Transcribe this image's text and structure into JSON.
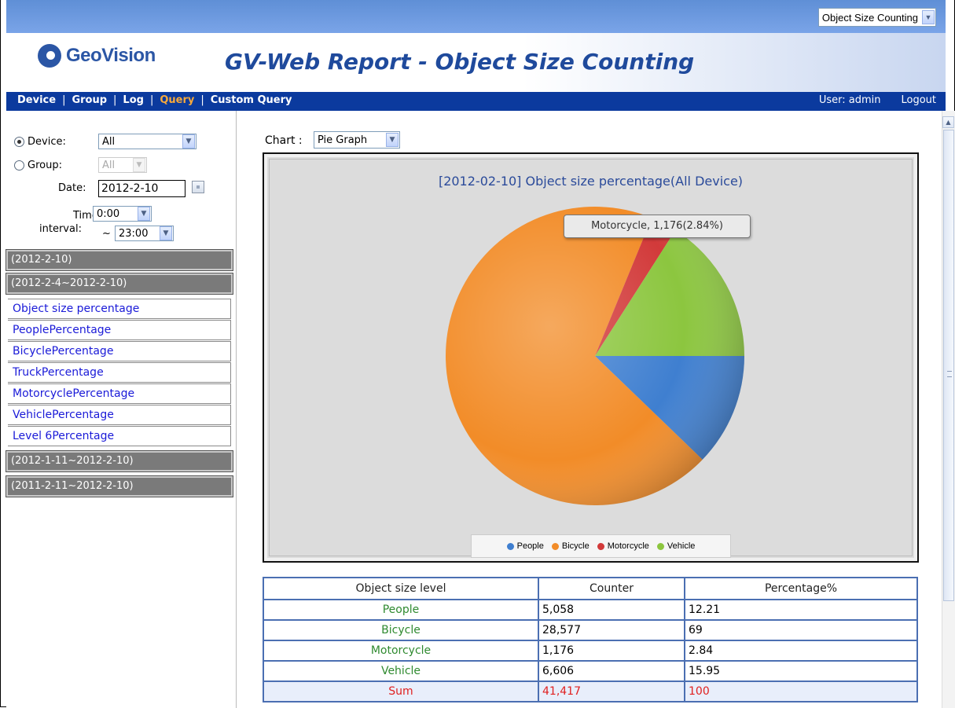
{
  "report_selector": {
    "value": "Object Size Counting"
  },
  "header": {
    "logo_text": "GeoVision",
    "title": "GV-Web Report - Object Size Counting"
  },
  "nav": {
    "items": [
      "Device",
      "Group",
      "Log",
      "Query",
      "Custom Query"
    ],
    "active": "Query",
    "user": "User: admin",
    "logout": "Logout"
  },
  "sidebar": {
    "device_label": "Device:",
    "device_value": "All",
    "group_label": "Group:",
    "group_value": "All",
    "date_label": "Date:",
    "date_value": "2012-2-10",
    "time_label": "Time",
    "interval_label": "interval:",
    "time_from": "0:00",
    "tilde": "~",
    "time_to": "23:00",
    "ranges": [
      "(2012-2-10)",
      "(2012-2-4~2012-2-10)",
      "(2012-1-11~2012-2-10)",
      "(2011-2-11~2012-2-10)"
    ],
    "links": [
      "Object size percentage",
      "PeoplePercentage",
      "BicyclePercentage",
      "TruckPercentage",
      "MotorcyclePercentage",
      "VehiclePercentage",
      "Level 6Percentage"
    ]
  },
  "chart_control": {
    "label": "Chart :",
    "value": "Pie Graph"
  },
  "colors": {
    "people": "#3f7fd0",
    "bicycle": "#f28c28",
    "motorcycle": "#d23a3a",
    "vehicle": "#8cc63f",
    "nav_bg": "#0b3a9e",
    "nav_active": "#f7a93b"
  },
  "chart_data": {
    "type": "pie",
    "title": "[2012-02-10] Object size percentage(All Device)",
    "categories": [
      "People",
      "Bicycle",
      "Motorcycle",
      "Vehicle"
    ],
    "values": [
      5058,
      28577,
      1176,
      6606
    ],
    "percentages": [
      12.21,
      69,
      2.84,
      15.95
    ],
    "tooltip": "Motorcycle, 1,176(2.84%)",
    "legend": "bottom"
  },
  "table": {
    "headers": [
      "Object size level",
      "Counter",
      "Percentage%"
    ],
    "rows": [
      [
        "People",
        "5,058",
        "12.21"
      ],
      [
        "Bicycle",
        "28,577",
        "69"
      ],
      [
        "Motorcycle",
        "1,176",
        "2.84"
      ],
      [
        "Vehicle",
        "6,606",
        "15.95"
      ]
    ],
    "sum": [
      "Sum",
      "41,417",
      "100"
    ]
  }
}
